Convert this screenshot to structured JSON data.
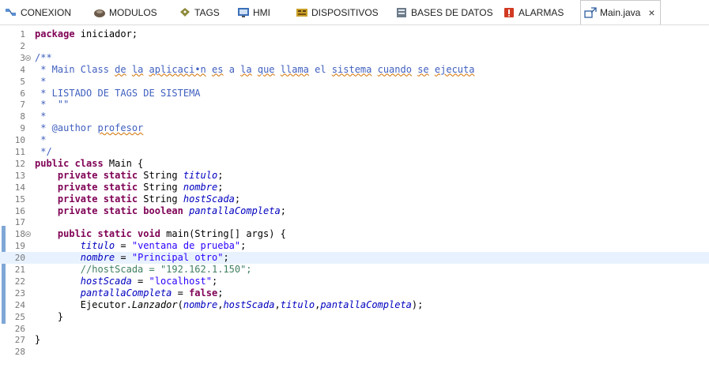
{
  "tabs": [
    {
      "label": "CONEXION",
      "icon": "connection-icon"
    },
    {
      "label": "MODULOS",
      "icon": "modules-icon"
    },
    {
      "label": "TAGS",
      "icon": "tag-icon"
    },
    {
      "label": "HMI",
      "icon": "screen-icon"
    },
    {
      "label": "DISPOSITIVOS",
      "icon": "devices-icon"
    },
    {
      "label": "BASES DE DATOS",
      "icon": "database-icon"
    },
    {
      "label": "ALARMAS",
      "icon": "alarm-icon"
    },
    {
      "label": "Main.java",
      "icon": "java-file-icon",
      "active": true,
      "close": "×"
    }
  ],
  "editor": {
    "current_line": 20,
    "lines": [
      {
        "n": "1",
        "t": [
          {
            "c": "kw",
            "s": "package"
          },
          {
            "s": " iniciador;"
          }
        ]
      },
      {
        "n": "2",
        "t": []
      },
      {
        "n": "3",
        "fold": true,
        "t": [
          {
            "c": "dc",
            "s": "/**"
          }
        ]
      },
      {
        "n": "4",
        "t": [
          {
            "c": "dc",
            "s": " * Main Class "
          },
          {
            "c": "dc sq",
            "s": "de"
          },
          {
            "c": "dc",
            "s": " "
          },
          {
            "c": "dc sq",
            "s": "la"
          },
          {
            "c": "dc",
            "s": " "
          },
          {
            "c": "dc sq",
            "s": "aplicaci•n"
          },
          {
            "c": "dc",
            "s": " "
          },
          {
            "c": "dc sq",
            "s": "es"
          },
          {
            "c": "dc",
            "s": " a "
          },
          {
            "c": "dc sq",
            "s": "la"
          },
          {
            "c": "dc",
            "s": " "
          },
          {
            "c": "dc sq",
            "s": "que"
          },
          {
            "c": "dc",
            "s": " "
          },
          {
            "c": "dc sq",
            "s": "llama"
          },
          {
            "c": "dc",
            "s": " el "
          },
          {
            "c": "dc sq",
            "s": "sistema"
          },
          {
            "c": "dc",
            "s": " "
          },
          {
            "c": "dc sq",
            "s": "cuando"
          },
          {
            "c": "dc",
            "s": " "
          },
          {
            "c": "dc sq",
            "s": "se"
          },
          {
            "c": "dc",
            "s": " "
          },
          {
            "c": "dc sq",
            "s": "ejecuta"
          }
        ]
      },
      {
        "n": "5",
        "t": [
          {
            "c": "dc",
            "s": " *"
          }
        ]
      },
      {
        "n": "6",
        "t": [
          {
            "c": "dc",
            "s": " * LISTADO DE TAGS DE SISTEMA"
          }
        ]
      },
      {
        "n": "7",
        "t": [
          {
            "c": "dc",
            "s": " *  \"\""
          }
        ]
      },
      {
        "n": "8",
        "t": [
          {
            "c": "dc",
            "s": " *"
          }
        ]
      },
      {
        "n": "9",
        "t": [
          {
            "c": "dc",
            "s": " * @author "
          },
          {
            "c": "dc sq",
            "s": "profesor"
          }
        ]
      },
      {
        "n": "10",
        "t": [
          {
            "c": "dc",
            "s": " *"
          }
        ]
      },
      {
        "n": "11",
        "t": [
          {
            "c": "dc",
            "s": " */"
          }
        ]
      },
      {
        "n": "12",
        "t": [
          {
            "c": "kw",
            "s": "public class"
          },
          {
            "s": " Main {"
          }
        ]
      },
      {
        "n": "13",
        "t": [
          {
            "s": "    "
          },
          {
            "c": "kw",
            "s": "private static"
          },
          {
            "s": " String "
          },
          {
            "c": "fld",
            "s": "titulo"
          },
          {
            "s": ";"
          }
        ]
      },
      {
        "n": "14",
        "t": [
          {
            "s": "    "
          },
          {
            "c": "kw",
            "s": "private static"
          },
          {
            "s": " String "
          },
          {
            "c": "fld",
            "s": "nombre"
          },
          {
            "s": ";"
          }
        ]
      },
      {
        "n": "15",
        "t": [
          {
            "s": "    "
          },
          {
            "c": "kw",
            "s": "private static"
          },
          {
            "s": " String "
          },
          {
            "c": "fld",
            "s": "hostScada"
          },
          {
            "s": ";"
          }
        ]
      },
      {
        "n": "16",
        "t": [
          {
            "s": "    "
          },
          {
            "c": "kw",
            "s": "private static boolean"
          },
          {
            "s": " "
          },
          {
            "c": "fld",
            "s": "pantallaCompleta"
          },
          {
            "s": ";"
          }
        ]
      },
      {
        "n": "17",
        "t": []
      },
      {
        "n": "18",
        "fold": true,
        "t": [
          {
            "s": "    "
          },
          {
            "c": "kw",
            "s": "public static void"
          },
          {
            "s": " main(String[] args) {"
          }
        ]
      },
      {
        "n": "19",
        "t": [
          {
            "s": "        "
          },
          {
            "c": "fld",
            "s": "titulo"
          },
          {
            "s": " = "
          },
          {
            "c": "str",
            "s": "\"ventana de prueba\""
          },
          {
            "s": ";"
          }
        ]
      },
      {
        "n": "20",
        "t": [
          {
            "s": "        "
          },
          {
            "c": "fld",
            "s": "nombre"
          },
          {
            "s": " = "
          },
          {
            "c": "str",
            "s": "\"Principal otro\""
          },
          {
            "s": ";"
          }
        ]
      },
      {
        "n": "21",
        "t": [
          {
            "s": "        "
          },
          {
            "c": "cm",
            "s": "//hostScada = \"192.162.1.150\";"
          }
        ]
      },
      {
        "n": "22",
        "t": [
          {
            "s": "        "
          },
          {
            "c": "fld",
            "s": "hostScada"
          },
          {
            "s": " = "
          },
          {
            "c": "str",
            "s": "\"localhost\""
          },
          {
            "s": ";"
          }
        ]
      },
      {
        "n": "23",
        "t": [
          {
            "s": "        "
          },
          {
            "c": "fld",
            "s": "pantallaCompleta"
          },
          {
            "s": " = "
          },
          {
            "c": "kw",
            "s": "false"
          },
          {
            "s": ";"
          }
        ]
      },
      {
        "n": "24",
        "t": [
          {
            "s": "        Ejecutor."
          },
          {
            "c": "mth",
            "s": "Lanzador"
          },
          {
            "s": "("
          },
          {
            "c": "fld",
            "s": "nombre"
          },
          {
            "s": ","
          },
          {
            "c": "fld",
            "s": "hostScada"
          },
          {
            "s": ","
          },
          {
            "c": "fld",
            "s": "titulo"
          },
          {
            "s": ","
          },
          {
            "c": "fld",
            "s": "pantallaCompleta"
          },
          {
            "s": ");"
          }
        ]
      },
      {
        "n": "25",
        "t": [
          {
            "s": "    }"
          }
        ]
      },
      {
        "n": "26",
        "t": []
      },
      {
        "n": "27",
        "t": [
          {
            "s": "}"
          }
        ]
      },
      {
        "n": "28",
        "t": []
      }
    ]
  },
  "colors": {
    "keyword": "#7f0055",
    "javadoc": "#3f5fbf",
    "comment": "#3f7f5f",
    "field": "#0000c0",
    "string": "#2a00ff",
    "current_line": "#e8f2fe",
    "ruler_mark": "#7fa7d6"
  }
}
